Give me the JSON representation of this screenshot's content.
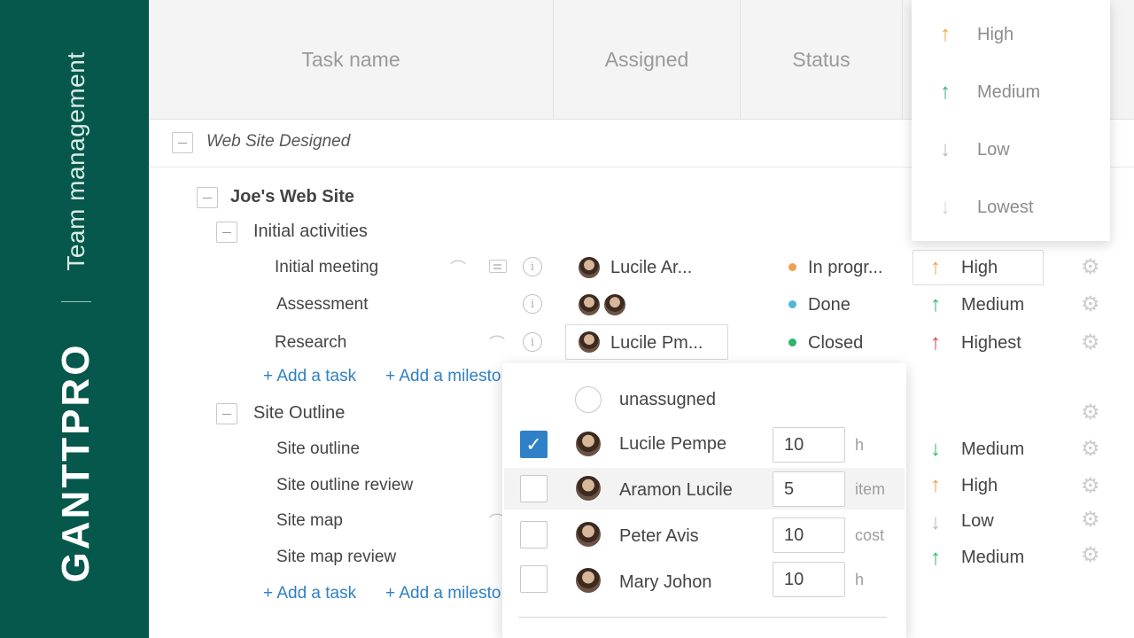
{
  "brand": {
    "section_title": "Team management",
    "logo": "GANTTPRO",
    "bg_color": "#07584c"
  },
  "header": {
    "task_name": "Task name",
    "assigned": "Assigned",
    "status": "Status"
  },
  "group": {
    "title": "Web Site Designed"
  },
  "project": {
    "title": "Joe's Web Site"
  },
  "subprojects": [
    {
      "title": "Initial activities"
    },
    {
      "title": "Site Outline"
    }
  ],
  "tasks": [
    {
      "name": "Initial meeting",
      "assignee": "Lucile Ar...",
      "status": "In progr...",
      "status_color": "#f0a04b",
      "priority": "High",
      "arrow": "up",
      "arrow_color": "#f0a04b"
    },
    {
      "name": "Assessment",
      "assignee": "",
      "status": "Done",
      "status_color": "#4fb8d8",
      "priority": "Medium",
      "arrow": "up",
      "arrow_color": "#2fb36f"
    },
    {
      "name": "Research",
      "assignee": "Lucile  Pm...",
      "status": "Closed",
      "status_color": "#2fb36f",
      "priority": "Highest",
      "arrow": "up",
      "arrow_color": "#d8424c"
    },
    {
      "name": "Site outline",
      "priority": "Medium",
      "arrow": "down",
      "arrow_color": "#2fb36f"
    },
    {
      "name": "Site outline review",
      "priority": "High",
      "arrow": "up",
      "arrow_color": "#f0a04b"
    },
    {
      "name": "Site map",
      "priority": "Low",
      "arrow": "down",
      "arrow_color": "#b8b8b8"
    },
    {
      "name": "Site map review",
      "priority": "Medium",
      "arrow": "up",
      "arrow_color": "#2fb36f"
    }
  ],
  "actions": {
    "add_task": "+ Add a task",
    "add_milestone": "+ Add a milesto"
  },
  "priority_dropdown": [
    {
      "label": "High",
      "arrow": "up",
      "color": "#f0a04b"
    },
    {
      "label": "Medium",
      "arrow": "up",
      "color": "#2fb36f"
    },
    {
      "label": "Low",
      "arrow": "down",
      "color": "#b8b8b8"
    },
    {
      "label": "Lowest",
      "arrow": "down",
      "color": "#d6d6d6"
    }
  ],
  "assignee_dropdown": {
    "unassigned_label": "unassugned",
    "people": [
      {
        "name": "Lucile  Pempe",
        "checked": true,
        "value": "10",
        "unit": "h"
      },
      {
        "name": "Aramon Lucile",
        "checked": false,
        "value": "5",
        "unit": "item"
      },
      {
        "name": "Peter Avis",
        "checked": false,
        "value": "10",
        "unit": "cost"
      },
      {
        "name": "Mary Johon",
        "checked": false,
        "value": "10",
        "unit": "h"
      }
    ]
  },
  "icons": {
    "check": "✓",
    "gear": "⚙",
    "info": "i",
    "clip": "⌒",
    "up": "↑",
    "down": "↓"
  }
}
